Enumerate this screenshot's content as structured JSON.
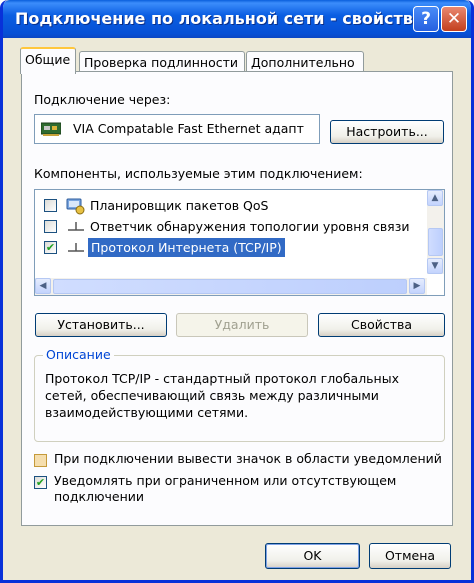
{
  "window": {
    "title": "Подключение по локальной сети - свойства",
    "help_button": "?",
    "close_button": "✕"
  },
  "tabs": [
    {
      "label": "Общие",
      "active": true
    },
    {
      "label": "Проверка подлинности",
      "active": false
    },
    {
      "label": "Дополнительно",
      "active": false
    }
  ],
  "general": {
    "connect_using_label": "Подключение через:",
    "adapter_name": "VIA Compatable Fast Ethernet адапт",
    "configure_button": "Настроить...",
    "components_label": "Компоненты, используемые этим подключением:",
    "components": [
      {
        "label": "Планировщик пакетов QoS",
        "checked": false,
        "selected": false,
        "icon": "qos-icon"
      },
      {
        "label": "Ответчик обнаружения топологии уровня связи",
        "checked": false,
        "selected": false,
        "icon": "protocol-icon"
      },
      {
        "label": "Протокол Интернета (TCP/IP)",
        "checked": true,
        "selected": true,
        "icon": "protocol-icon"
      }
    ],
    "install_button": "Установить...",
    "uninstall_button": "Удалить",
    "properties_button": "Свойства",
    "description": {
      "legend": "Описание",
      "text": "Протокол TCP/IP - стандартный протокол глобальных сетей, обеспечивающий связь между различными взаимодействующими сетями."
    },
    "show_icon_option": {
      "label": "При подключении вывести значок в области уведомлений",
      "checked": false
    },
    "notify_option": {
      "label": "Уведомлять при ограниченном или отсутствующем подключении",
      "checked": true
    }
  },
  "footer": {
    "ok_button": "OK",
    "cancel_button": "Отмена"
  },
  "colors": {
    "titlebar": "#0650d6",
    "selection": "#316ac5",
    "check_mark": "#21a121",
    "dialog_bg": "#ece9d8"
  }
}
